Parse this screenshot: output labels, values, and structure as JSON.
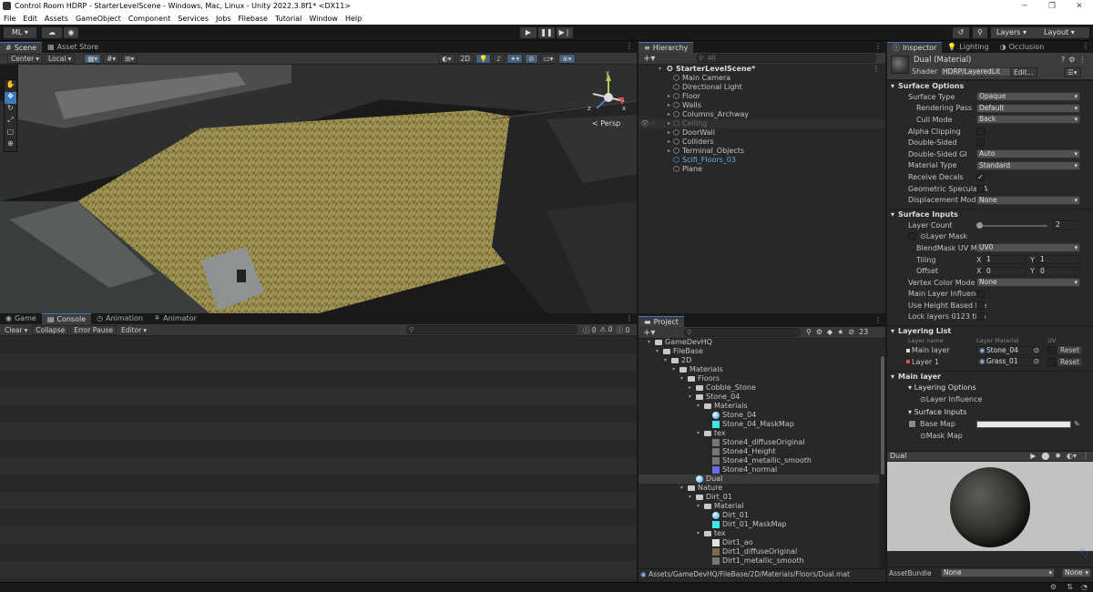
{
  "window": {
    "title": "Control Room HDRP - StarterLevelScene - Windows, Mac, Linux - Unity 2022.3.8f1* <DX11>"
  },
  "menu": [
    "File",
    "Edit",
    "Assets",
    "GameObject",
    "Component",
    "Services",
    "Jobs",
    "Filebase",
    "Tutorial",
    "Window",
    "Help"
  ],
  "toolbar": {
    "account": "ML",
    "layers": "Layers",
    "layout": "Layout"
  },
  "scene": {
    "tabs": [
      "Scene",
      "Asset Store"
    ],
    "pivot": "Center",
    "space": "Local",
    "mode2d": "2D",
    "persp": "< Persp"
  },
  "game": {
    "tabs": [
      "Game",
      "Console",
      "Animation",
      "Animator"
    ],
    "buttons": [
      "Clear",
      "Collapse",
      "Error Pause",
      "Editor"
    ],
    "counts": [
      "0",
      "0",
      "0"
    ]
  },
  "hierarchy": {
    "tab": "Hierarchy",
    "search": "All",
    "root": "StarterLevelScene*",
    "items": [
      "Main Camera",
      "Directional Light",
      "Floor",
      "Walls",
      "Columns_Archway",
      "Ceiling",
      "DoorWall",
      "Colliders",
      "Terminal_Objects",
      "Scifi_Floors_03",
      "Plane"
    ]
  },
  "project": {
    "tab": "Project",
    "count": "23",
    "path": "Assets/GameDevHQ/FileBase/2D/Materials/Floors/Dual.mat",
    "items": [
      {
        "t": "GameDevHQ",
        "d": 0,
        "k": "folder",
        "o": true
      },
      {
        "t": "FileBase",
        "d": 1,
        "k": "folder",
        "o": true
      },
      {
        "t": "2D",
        "d": 2,
        "k": "folder",
        "o": true
      },
      {
        "t": "Materials",
        "d": 3,
        "k": "folder",
        "o": true
      },
      {
        "t": "Floors",
        "d": 4,
        "k": "folder",
        "o": true
      },
      {
        "t": "Cobble_Stone",
        "d": 5,
        "k": "folder",
        "o": false
      },
      {
        "t": "Stone_04",
        "d": 5,
        "k": "folder",
        "o": true
      },
      {
        "t": "Materials",
        "d": 6,
        "k": "folder",
        "o": true
      },
      {
        "t": "Stone_04",
        "d": 7,
        "k": "mat"
      },
      {
        "t": "Stone_04_MaskMap",
        "d": 7,
        "k": "cyan"
      },
      {
        "t": "tex",
        "d": 6,
        "k": "folder",
        "o": true
      },
      {
        "t": "Stone4_diffuseOriginal",
        "d": 7,
        "k": "gray"
      },
      {
        "t": "Stone4_Height",
        "d": 7,
        "k": "gray"
      },
      {
        "t": "Stone4_metallic_smooth",
        "d": 7,
        "k": "gray"
      },
      {
        "t": "Stone4_normal",
        "d": 7,
        "k": "blue"
      },
      {
        "t": "Dual",
        "d": 5,
        "k": "mat",
        "sel": true
      },
      {
        "t": "Nature",
        "d": 4,
        "k": "folder",
        "o": true
      },
      {
        "t": "Dirt_01",
        "d": 5,
        "k": "folder",
        "o": true
      },
      {
        "t": "Material",
        "d": 6,
        "k": "folder",
        "o": true
      },
      {
        "t": "Dirt_01",
        "d": 7,
        "k": "mat"
      },
      {
        "t": "Dirt_01_MaskMap",
        "d": 7,
        "k": "cyan"
      },
      {
        "t": "tex",
        "d": 6,
        "k": "folder",
        "o": true
      },
      {
        "t": "Dirt1_ao",
        "d": 7,
        "k": "white"
      },
      {
        "t": "Dirt1_diffuseOriginal",
        "d": 7,
        "k": "brown"
      },
      {
        "t": "Dirt1_metallic_smooth",
        "d": 7,
        "k": "gray"
      }
    ]
  },
  "inspector": {
    "tabs": [
      "Inspector",
      "Lighting",
      "Occlusion"
    ],
    "name": "Dual (Material)",
    "shader_label": "Shader",
    "shader": "HDRP/LayeredLit",
    "edit": "Edit...",
    "surface_options": "Surface Options",
    "so": [
      [
        "Surface Type",
        "Opaque",
        "dd"
      ],
      [
        "Rendering Pass",
        "Default",
        "dd"
      ],
      [
        "Cull Mode",
        "Back",
        "dd"
      ],
      [
        "Alpha Clipping",
        "",
        "chk"
      ],
      [
        "Double-Sided",
        "",
        "chk"
      ],
      [
        "Double-Sided GI",
        "Auto",
        "dd"
      ],
      [
        "Material Type",
        "Standard",
        "dd"
      ],
      [
        "Receive Decals",
        "✓",
        "chk"
      ],
      [
        "Geometric Specular A",
        "",
        "chk"
      ],
      [
        "Displacement Mode",
        "None",
        "dd"
      ]
    ],
    "surface_inputs": "Surface Inputs",
    "layer_count": "Layer Count",
    "layer_count_val": "2",
    "layer_mask": "Layer Mask",
    "blend_label": "BlendMask UV Ma",
    "blend_val": "UV0",
    "tiling": "Tiling",
    "offset": "Offset",
    "tx": "1",
    "ty": "1",
    "ox": "0",
    "oy": "0",
    "x": "X",
    "y": "Y",
    "vcm": "Vertex Color Mode",
    "vcm_val": "None",
    "mli": "Main Layer Influence",
    "uhb": "Use Height Based Ble",
    "lock": "Lock layers 0123 tilin",
    "layering_list": "Layering List",
    "ll_cols": [
      "Layer name",
      "Layer Material",
      "UV"
    ],
    "layers": [
      [
        "Main layer",
        "Stone_04"
      ],
      [
        "Layer 1",
        "Grass_01"
      ]
    ],
    "reset": "Reset",
    "main_layer": "Main layer",
    "layering_options": "Layering Options",
    "layer_influence": "Layer Influence",
    "si2": "Surface Inputs",
    "base_map": "Base Map",
    "mask_map": "Mask Map",
    "preview_name": "Dual",
    "assetbundle": "AssetBundle",
    "ab1": "None",
    "ab2": "None"
  },
  "colors": {
    "accent": "#3a79bb",
    "bg": "#282828",
    "grass": "#7a7a3a"
  }
}
